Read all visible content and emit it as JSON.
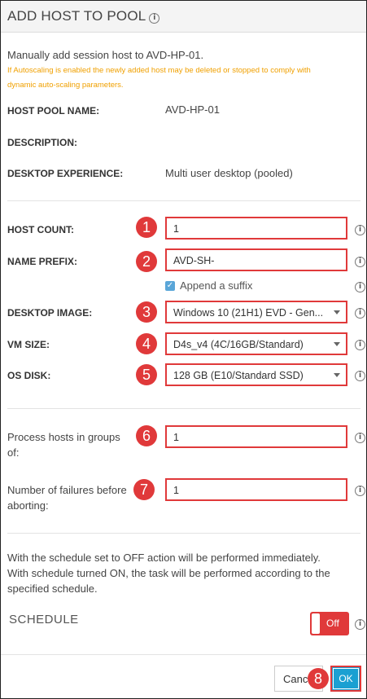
{
  "dialog": {
    "title": "ADD HOST TO POOL",
    "subtitle": "Manually add session host to AVD-HP-01.",
    "warning_line1": "If Autoscaling is enabled the newly added host may be deleted or stopped to comply with",
    "warning_line2": "dynamic auto-scaling parameters."
  },
  "info_icon_glyph": "i",
  "details": {
    "host_pool_name_label": "HOST POOL NAME:",
    "host_pool_name_value": "AVD-HP-01",
    "description_label": "DESCRIPTION:",
    "desktop_experience_label": "DESKTOP EXPERIENCE:",
    "desktop_experience_value": "Multi user desktop (pooled)"
  },
  "form": {
    "host_count_label": "HOST COUNT:",
    "host_count_value": "1",
    "name_prefix_label": "NAME PREFIX:",
    "name_prefix_value": "AVD-SH-",
    "append_suffix_label": "Append a suffix",
    "append_suffix_checked": true,
    "desktop_image_label": "DESKTOP IMAGE:",
    "desktop_image_value": "Windows 10 (21H1) EVD - Gen...",
    "vm_size_label": "VM SIZE:",
    "vm_size_value": "D4s_v4 (4C/16GB/Standard)",
    "os_disk_label": "OS DISK:",
    "os_disk_value": "128 GB (E10/Standard SSD)",
    "groups_label_line1": "Process hosts in groups",
    "groups_label_line2": "of:",
    "groups_value": "1",
    "failures_label_line1": "Number of failures before",
    "failures_label_line2": "aborting:",
    "failures_value": "1"
  },
  "schedule": {
    "note_line1": "With the schedule set to OFF action will be performed immediately.",
    "note_line2": "With schedule turned ON, the task will be performed according to the",
    "note_line3": "specified schedule.",
    "label": "SCHEDULE",
    "toggle_text": "Off"
  },
  "buttons": {
    "cancel": "Cancel",
    "ok": "OK"
  },
  "annotations": [
    "1",
    "2",
    "3",
    "4",
    "5",
    "6",
    "7",
    "8"
  ],
  "colors": {
    "highlight": "#e0393a",
    "warning": "#f0a000",
    "ok_button": "#1aa0d2",
    "checkbox": "#5aa6d8"
  }
}
